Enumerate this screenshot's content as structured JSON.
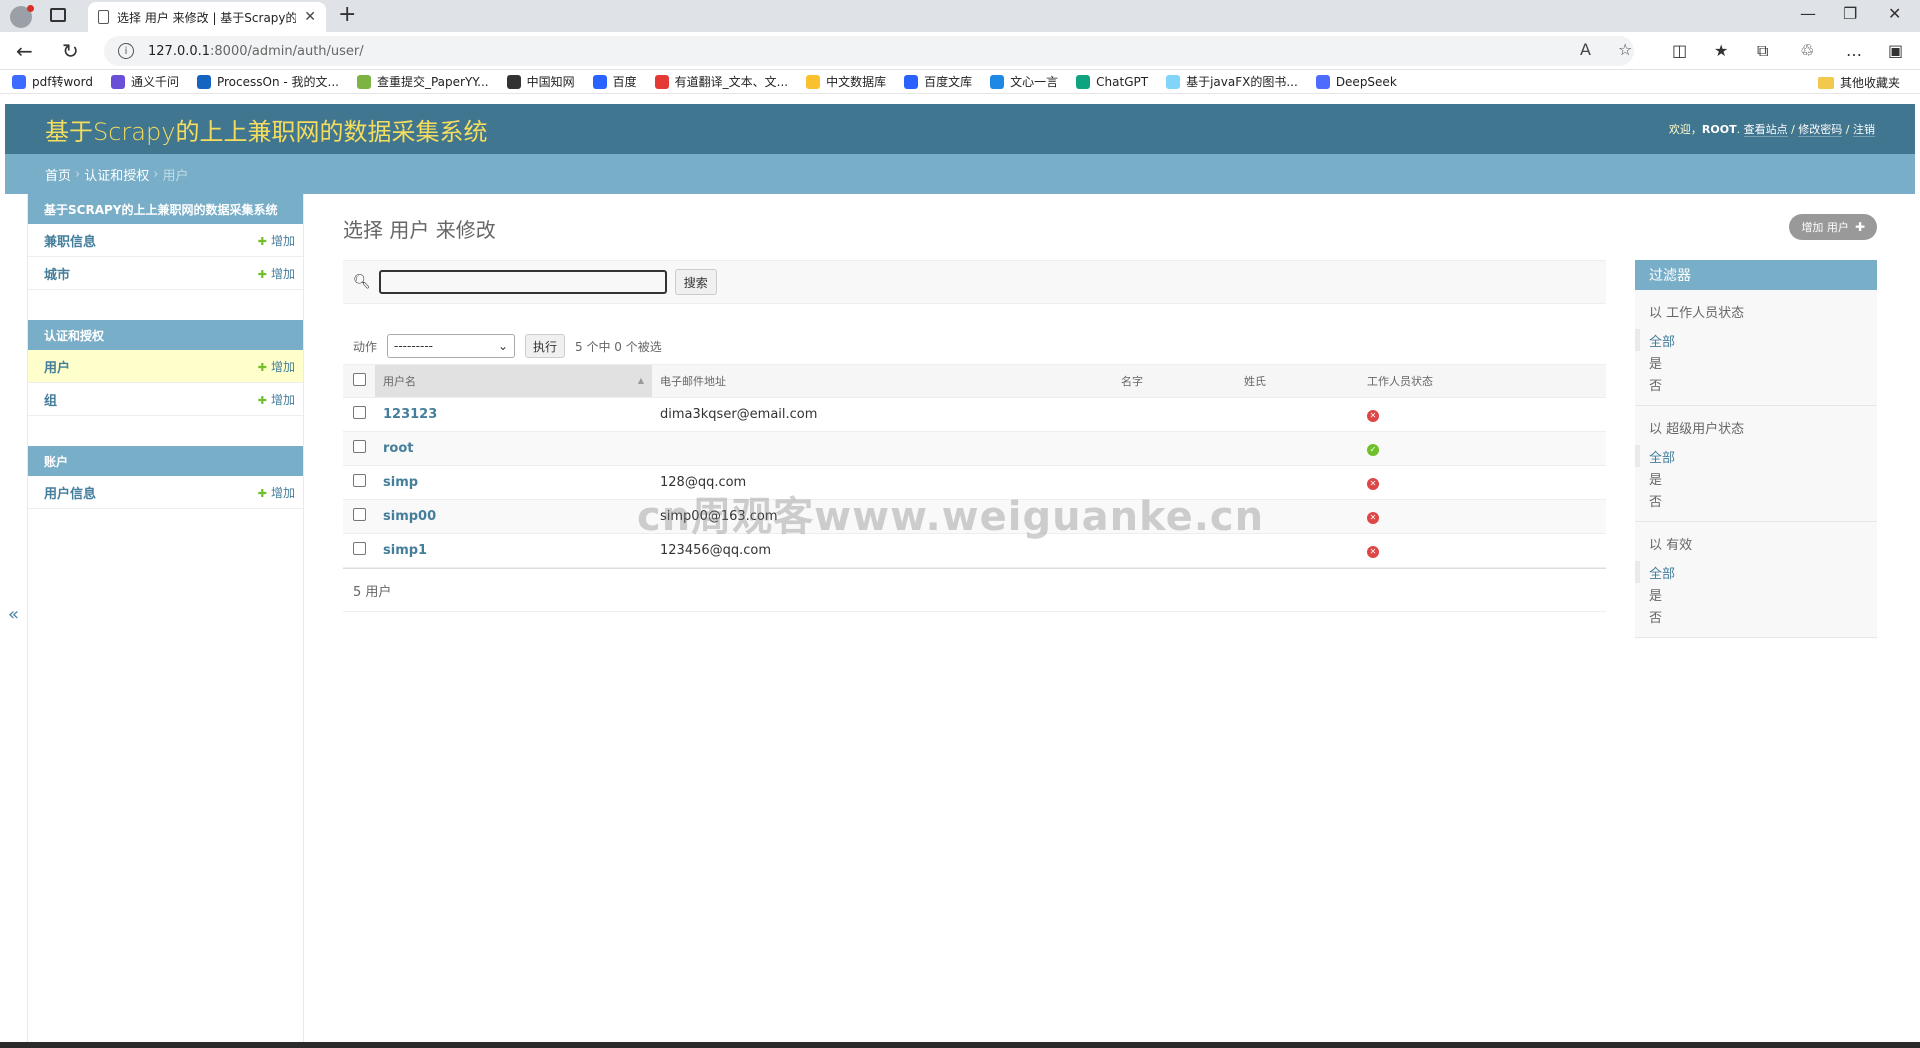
{
  "browser": {
    "tab_title": "选择 用户 来修改 | 基于Scrapy的",
    "url_host": "127.0.0.1",
    "url_rest": ":8000/admin/auth/user/",
    "bookmarks": [
      {
        "label": "pdf转word",
        "color": "#3b6cff"
      },
      {
        "label": "通义千问",
        "color": "#6a4fd8"
      },
      {
        "label": "ProcessOn - 我的文...",
        "color": "#1565c0"
      },
      {
        "label": "查重提交_PaperYY...",
        "color": "#7cb342"
      },
      {
        "label": "中国知网",
        "color": "#333333"
      },
      {
        "label": "百度",
        "color": "#2962ff"
      },
      {
        "label": "有道翻译_文本、文...",
        "color": "#e53935"
      },
      {
        "label": "中文数据库",
        "color": "#fbc02d"
      },
      {
        "label": "百度文库",
        "color": "#2962ff"
      },
      {
        "label": "文心一言",
        "color": "#1e88e5"
      },
      {
        "label": "ChatGPT",
        "color": "#10a37f"
      },
      {
        "label": "基于javaFX的图书...",
        "color": "#81d4fa"
      },
      {
        "label": "DeepSeek",
        "color": "#4d6bfe"
      }
    ],
    "other_bookmarks": "其他收藏夹"
  },
  "header": {
    "brand": "基于Scrapy的上上兼职网的数据采集系统",
    "welcome": "欢迎，",
    "user": "ROOT",
    "period": ".",
    "view_site": "查看站点",
    "change_password": "修改密码",
    "logout": "注销",
    "slash": " / "
  },
  "breadcrumbs": {
    "home": "首页",
    "app": "认证和授权",
    "current": "用户",
    "sep": "›"
  },
  "sidebar": {
    "toggle": "«",
    "modules": [
      {
        "caption": "基于SCRAPY的上上兼职网的数据采集系统",
        "rows": [
          {
            "name": "兼职信息",
            "add": "增加",
            "current": false
          },
          {
            "name": "城市",
            "add": "增加",
            "current": false
          }
        ]
      },
      {
        "caption": "认证和授权",
        "rows": [
          {
            "name": "用户",
            "add": "增加",
            "current": true
          },
          {
            "name": "组",
            "add": "增加",
            "current": false
          }
        ]
      },
      {
        "caption": "账户",
        "rows": [
          {
            "name": "用户信息",
            "add": "增加",
            "current": false
          }
        ]
      }
    ]
  },
  "content": {
    "title": "选择 用户 来修改",
    "add_button": "增加 用户",
    "search_button": "搜索",
    "action_label": "动作",
    "action_default": "---------",
    "go_button": "执行",
    "selection_counter": "5 个中 0 个被选",
    "columns": [
      "用户名",
      "电子邮件地址",
      "名字",
      "姓氏",
      "工作人员状态"
    ],
    "rows": [
      {
        "username": "123123",
        "email": "dima3kqser@email.com",
        "first": "",
        "last": "",
        "staff": false
      },
      {
        "username": "root",
        "email": "",
        "first": "",
        "last": "",
        "staff": true
      },
      {
        "username": "simp",
        "email": "128@qq.com",
        "first": "",
        "last": "",
        "staff": false
      },
      {
        "username": "simp00",
        "email": "simp00@163.com",
        "first": "",
        "last": "",
        "staff": false
      },
      {
        "username": "simp1",
        "email": "123456@qq.com",
        "first": "",
        "last": "",
        "staff": false
      }
    ],
    "paginator": "5 用户"
  },
  "filter": {
    "title": "过滤器",
    "groups": [
      {
        "title": "以 工作人员状态",
        "options": [
          "全部",
          "是",
          "否"
        ]
      },
      {
        "title": "以 超级用户状态",
        "options": [
          "全部",
          "是",
          "否"
        ]
      },
      {
        "title": "以 有效",
        "options": [
          "全部",
          "是",
          "否"
        ]
      }
    ]
  },
  "watermark": "cn周观客www.weiguanke.cn"
}
